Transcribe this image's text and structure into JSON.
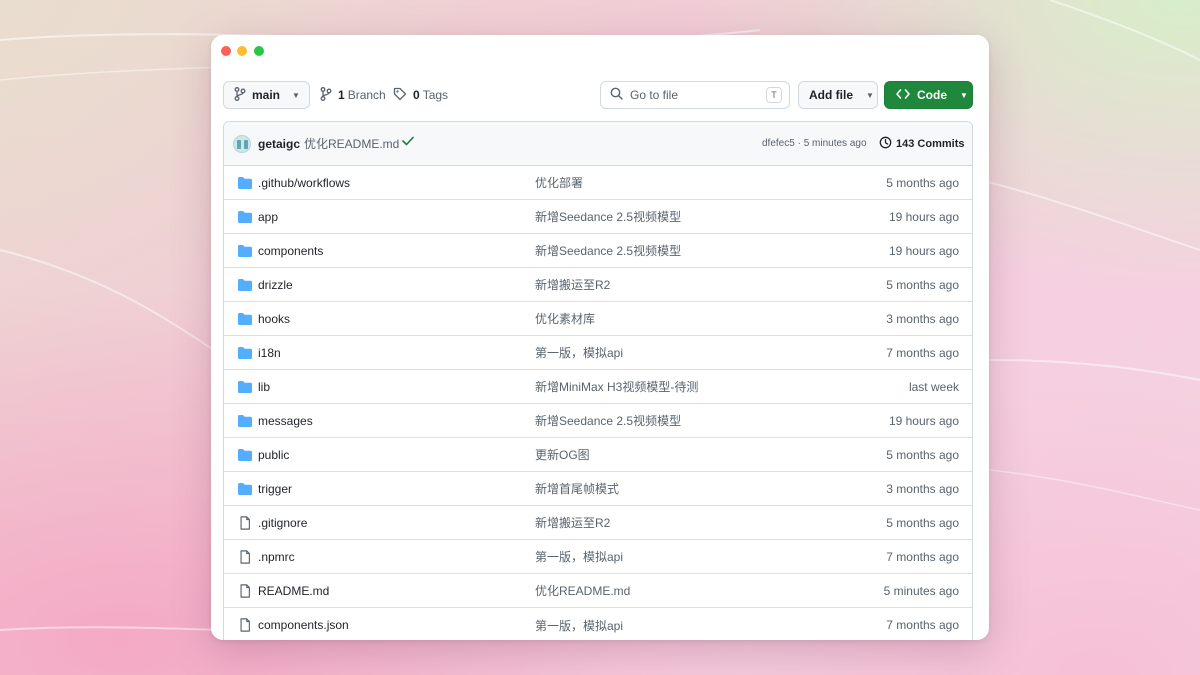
{
  "toolbar": {
    "branch": "main",
    "branches_count": "1",
    "branches_label": "Branch",
    "tags_count": "0",
    "tags_label": "Tags",
    "search_placeholder": "Go to file",
    "search_shortcut": "T",
    "add_file_label": "Add file",
    "code_label": "Code"
  },
  "commit": {
    "author": "getaigc",
    "message": "优化README.md",
    "hash_time": "dfefec5 · 5 minutes ago",
    "commits_count": "143",
    "commits_label": "Commits"
  },
  "files": [
    {
      "type": "folder",
      "name": ".github/workflows",
      "message": "优化部署",
      "age": "5 months ago"
    },
    {
      "type": "folder",
      "name": "app",
      "message": "新增Seedance 2.5视频模型",
      "age": "19 hours ago"
    },
    {
      "type": "folder",
      "name": "components",
      "message": "新增Seedance 2.5视频模型",
      "age": "19 hours ago"
    },
    {
      "type": "folder",
      "name": "drizzle",
      "message": "新增搬运至R2",
      "age": "5 months ago"
    },
    {
      "type": "folder",
      "name": "hooks",
      "message": "优化素材库",
      "age": "3 months ago"
    },
    {
      "type": "folder",
      "name": "i18n",
      "message": "第一版，模拟api",
      "age": "7 months ago"
    },
    {
      "type": "folder",
      "name": "lib",
      "message": "新增MiniMax H3视频模型-待测",
      "age": "last week"
    },
    {
      "type": "folder",
      "name": "messages",
      "message": "新增Seedance 2.5视频模型",
      "age": "19 hours ago"
    },
    {
      "type": "folder",
      "name": "public",
      "message": "更新OG图",
      "age": "5 months ago"
    },
    {
      "type": "folder",
      "name": "trigger",
      "message": "新增首尾帧模式",
      "age": "3 months ago"
    },
    {
      "type": "file",
      "name": ".gitignore",
      "message": "新增搬运至R2",
      "age": "5 months ago"
    },
    {
      "type": "file",
      "name": ".npmrc",
      "message": "第一版，模拟api",
      "age": "7 months ago"
    },
    {
      "type": "file",
      "name": "README.md",
      "message": "优化README.md",
      "age": "5 minutes ago"
    },
    {
      "type": "file",
      "name": "components.json",
      "message": "第一版，模拟api",
      "age": "7 months ago"
    }
  ],
  "colors": {
    "accent_green": "#1f883d",
    "folder_blue": "#54aeff",
    "text_primary": "#1f2328",
    "text_muted": "#59636e",
    "border": "#d1d9e0"
  }
}
